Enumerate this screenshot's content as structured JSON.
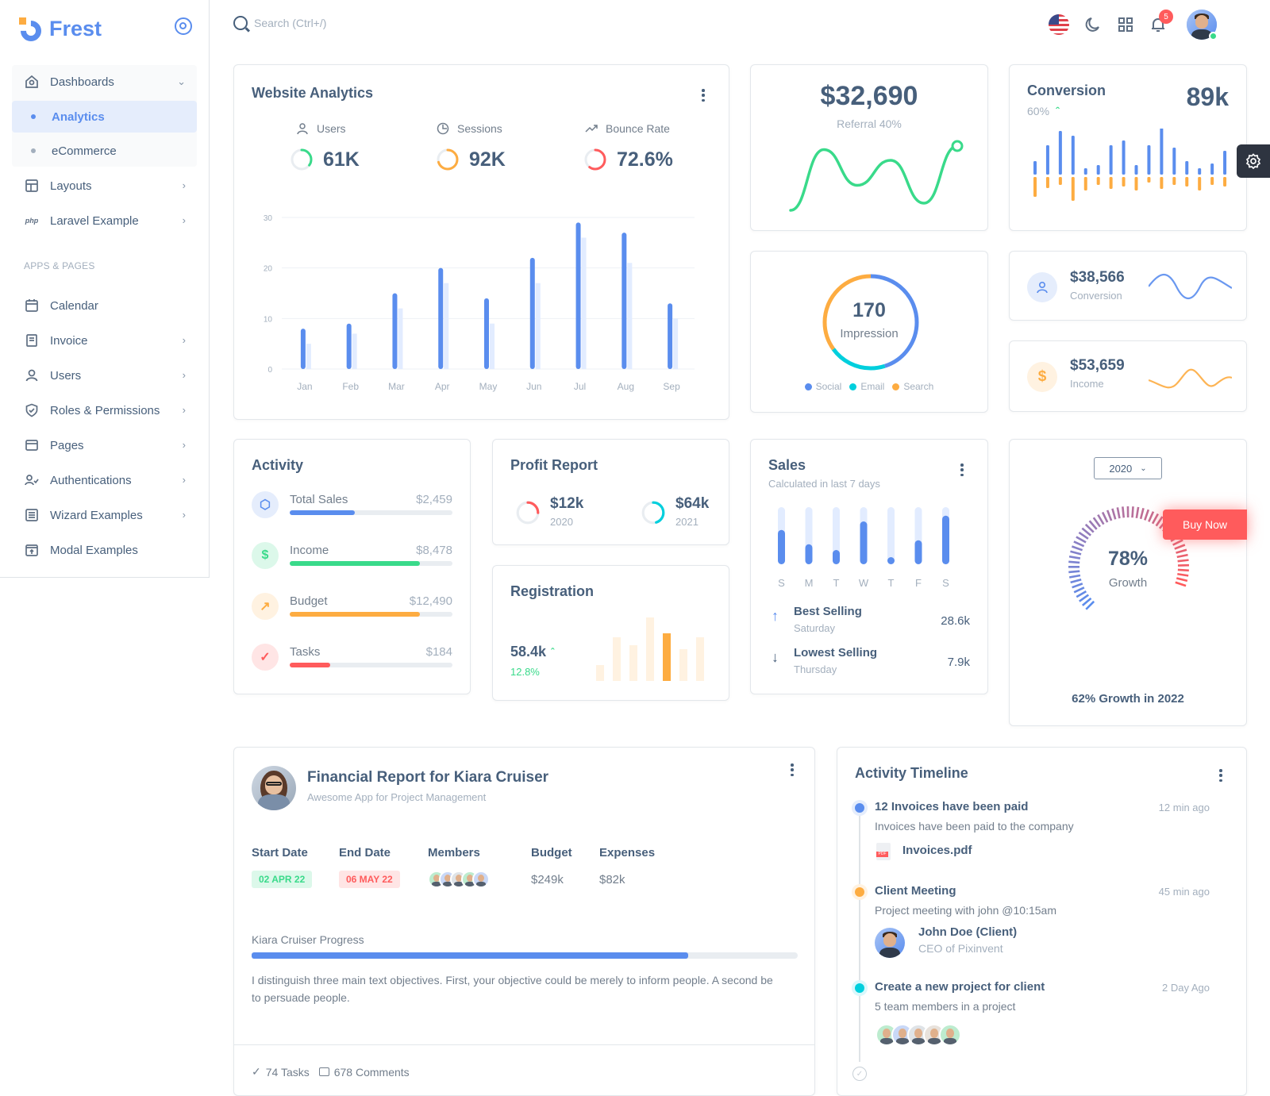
{
  "brand": {
    "name": "Frest"
  },
  "sidebar": {
    "items": [
      {
        "label": "Dashboards",
        "icon": "home-icon",
        "expanded": true
      },
      {
        "label": "Analytics",
        "active": true
      },
      {
        "label": "eCommerce"
      },
      {
        "label": "Layouts",
        "icon": "layout-icon"
      },
      {
        "label": "Laravel Example",
        "icon": "php-icon"
      }
    ],
    "section_label": "APPS & PAGES",
    "apps": [
      {
        "label": "Calendar",
        "icon": "calendar-icon"
      },
      {
        "label": "Invoice",
        "icon": "invoice-icon"
      },
      {
        "label": "Users",
        "icon": "user-icon"
      },
      {
        "label": "Roles & Permissions",
        "icon": "shield-check-icon"
      },
      {
        "label": "Pages",
        "icon": "window-icon"
      },
      {
        "label": "Authentications",
        "icon": "user-check-icon"
      },
      {
        "label": "Wizard Examples",
        "icon": "list-box-icon"
      },
      {
        "label": "Modal Examples",
        "icon": "modal-icon"
      }
    ]
  },
  "topbar": {
    "search_placeholder": "Search (Ctrl+/)",
    "notifications_count": "5",
    "icons": [
      "us-flag-icon",
      "moon-icon",
      "grid-icon",
      "bell-icon",
      "user-avatar"
    ]
  },
  "analytics": {
    "title": "Website Analytics",
    "stats": [
      {
        "label": "Users",
        "value": "61K",
        "color": "#39da8a",
        "fraction": 0.35
      },
      {
        "label": "Sessions",
        "value": "92K",
        "color": "#fdac41",
        "fraction": 0.7
      },
      {
        "label": "Bounce Rate",
        "value": "72.6%",
        "color": "#ff5b5c",
        "fraction": 0.6
      }
    ]
  },
  "chart_data": {
    "type": "bar",
    "title": "Website Analytics",
    "categories": [
      "Jan",
      "Feb",
      "Mar",
      "Apr",
      "May",
      "Jun",
      "Jul",
      "Aug",
      "Sep"
    ],
    "series": [
      {
        "name": "Primary",
        "values": [
          8,
          9,
          15,
          20,
          14,
          22,
          29,
          27,
          13
        ],
        "color": "#5a8dee"
      },
      {
        "name": "Secondary",
        "values": [
          5,
          7,
          12,
          17,
          9,
          17,
          26,
          21,
          10
        ],
        "color": "#e2ecff"
      }
    ],
    "yticks": [
      0,
      10,
      20,
      30
    ],
    "ylim": [
      0,
      30
    ],
    "grid": true
  },
  "referral": {
    "value": "$32,690",
    "label": "Referral 40%",
    "line": [
      0,
      85,
      35,
      70,
      10,
      90
    ]
  },
  "conversion": {
    "title": "Conversion",
    "value": "89k",
    "percent": "60%",
    "up": [
      17,
      37,
      55,
      49,
      8,
      12,
      37,
      43,
      12,
      37,
      59,
      34,
      17,
      8,
      14,
      30
    ],
    "down": [
      25,
      14,
      10,
      30,
      17,
      10,
      15,
      12,
      17,
      7,
      15,
      10,
      12,
      17,
      10,
      12
    ]
  },
  "impression": {
    "value": "170",
    "label": "Impression",
    "segments": [
      {
        "name": "Social",
        "fraction": 0.45,
        "color": "#5a8dee"
      },
      {
        "name": "Email",
        "fraction": 0.2,
        "color": "#00cfdd"
      },
      {
        "name": "Search",
        "fraction": 0.35,
        "color": "#fdac41"
      }
    ]
  },
  "mini_stats": [
    {
      "value": "$38,566",
      "label": "Conversion",
      "color": "#5a8dee",
      "bg": "#e5edfc"
    },
    {
      "value": "$53,659",
      "label": "Income",
      "color": "#fdac41",
      "bg": "#fff2e1"
    }
  ],
  "activity": {
    "title": "Activity",
    "items": [
      {
        "label": "Total Sales",
        "value": "$2,459",
        "progress": 0.4,
        "color": "#5a8dee",
        "bg": "#e5edfc"
      },
      {
        "label": "Income",
        "value": "$8,478",
        "progress": 0.8,
        "color": "#39da8a",
        "bg": "#dcf8ea"
      },
      {
        "label": "Budget",
        "value": "$12,490",
        "progress": 0.8,
        "color": "#fdac41",
        "bg": "#fff2e1"
      },
      {
        "label": "Tasks",
        "value": "$184",
        "progress": 0.25,
        "color": "#ff5b5c",
        "bg": "#ffe5e5"
      }
    ]
  },
  "profit": {
    "title": "Profit Report",
    "items": [
      {
        "value": "$12k",
        "year": "2020",
        "color": "#ff5b5c",
        "fraction": 0.25
      },
      {
        "value": "$64k",
        "year": "2021",
        "color": "#00cfdd",
        "fraction": 0.45
      }
    ]
  },
  "registration": {
    "title": "Registration",
    "value": "58.4k",
    "change": "12.8%",
    "bars": [
      20,
      55,
      45,
      80,
      60,
      40,
      55
    ],
    "highlight": 4
  },
  "sales": {
    "title": "Sales",
    "subtitle": "Calculated in last 7 days",
    "days": [
      "S",
      "M",
      "T",
      "W",
      "T",
      "F",
      "S"
    ],
    "values": [
      0.6,
      0.35,
      0.25,
      0.75,
      0.1,
      0.42,
      0.85
    ],
    "best": {
      "label": "Best Selling",
      "day": "Saturday",
      "value": "28.6k"
    },
    "lowest": {
      "label": "Lowest Selling",
      "day": "Thursday",
      "value": "7.9k"
    }
  },
  "growth": {
    "year": "2020",
    "value": "78%",
    "label": "Growth",
    "footer": "62% Growth in 2022",
    "fraction": 0.78
  },
  "buy_now": "Buy Now",
  "financial": {
    "title": "Financial Report for Kiara Cruiser",
    "subtitle": "Awesome App for Project Management",
    "headers": [
      "Start Date",
      "End Date",
      "Members",
      "Budget",
      "Expenses"
    ],
    "start": "02 APR 22",
    "end": "06 MAY 22",
    "budget": "$249k",
    "expenses": "$82k",
    "progress_label": "Kiara Cruiser Progress",
    "progress": 0.8,
    "description": "I distinguish three main text objectives. First, your objective could be merely to inform people. A second be to persuade people.",
    "tasks": "74 Tasks",
    "comments": "678 Comments"
  },
  "timeline": {
    "title": "Activity Timeline",
    "items": [
      {
        "title": "12 Invoices have been paid",
        "time": "12 min ago",
        "desc": "Invoices have been paid to the company",
        "file": "Invoices.pdf",
        "color": "#5a8dee"
      },
      {
        "title": "Client Meeting",
        "time": "45 min ago",
        "desc": "Project meeting with john @10:15am",
        "person": "John Doe (Client)",
        "role": "CEO of Pixinvent",
        "color": "#fdac41"
      },
      {
        "title": "Create a new project for client",
        "time": "2 Day Ago",
        "desc": "5 team members in a project",
        "color": "#00cfdd"
      }
    ]
  }
}
